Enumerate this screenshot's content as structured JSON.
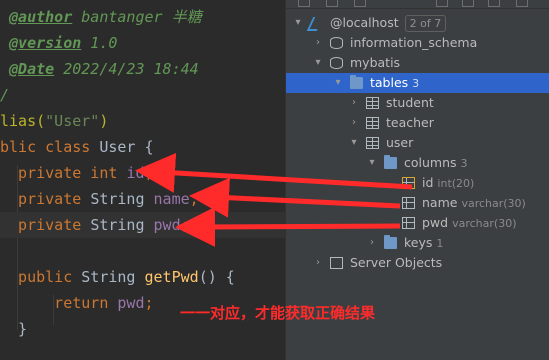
{
  "editor": {
    "lines": [
      {
        "segments": [
          {
            "t": " ",
            "c": "doc"
          },
          {
            "t": "@author",
            "c": "tag"
          },
          {
            "t": " bantanger 半糖",
            "c": "doc"
          }
        ]
      },
      {
        "segments": [
          {
            "t": " ",
            "c": "doc"
          },
          {
            "t": "@version",
            "c": "tag"
          },
          {
            "t": " 1.0",
            "c": "doc"
          }
        ]
      },
      {
        "segments": [
          {
            "t": " ",
            "c": "doc"
          },
          {
            "t": "@Date",
            "c": "tag"
          },
          {
            "t": " 2022/4/23 18:44",
            "c": "doc"
          }
        ]
      },
      {
        "segments": [
          {
            "t": "/",
            "c": "doc"
          }
        ]
      },
      {
        "segments": [
          {
            "t": "lias(",
            "c": "ann"
          },
          {
            "t": "\"User\"",
            "c": "str"
          },
          {
            "t": ")",
            "c": "ann"
          }
        ]
      },
      {
        "segments": [
          {
            "t": "blic class ",
            "c": "kw"
          },
          {
            "t": "User {",
            "c": ""
          }
        ]
      },
      {
        "segments": [
          {
            "t": "  private int ",
            "c": "kw"
          },
          {
            "t": "id",
            "c": "fld"
          },
          {
            "t": ";",
            "c": "kw"
          }
        ]
      },
      {
        "segments": [
          {
            "t": "  private ",
            "c": "kw"
          },
          {
            "t": "String ",
            "c": ""
          },
          {
            "t": "name",
            "c": "fld"
          },
          {
            "t": ";",
            "c": "kw"
          }
        ]
      },
      {
        "segments": [
          {
            "t": "  private ",
            "c": "kw"
          },
          {
            "t": "String ",
            "c": ""
          },
          {
            "t": "pwd",
            "c": "fld"
          },
          {
            "t": ";",
            "c": "kw"
          }
        ]
      },
      {
        "segments": [
          {
            "t": "",
            "c": ""
          }
        ]
      },
      {
        "segments": [
          {
            "t": "  public ",
            "c": "kw"
          },
          {
            "t": "String ",
            "c": ""
          },
          {
            "t": "getPwd",
            "c": "mth"
          },
          {
            "t": "() {",
            "c": ""
          }
        ]
      },
      {
        "segments": [
          {
            "t": "      return ",
            "c": "kw"
          },
          {
            "t": "pwd",
            "c": "fld"
          },
          {
            "t": ";",
            "c": "kw"
          }
        ]
      },
      {
        "segments": [
          {
            "t": "  }",
            "c": ""
          }
        ]
      }
    ]
  },
  "db_tree": {
    "items": [
      {
        "label": "@localhost",
        "badge": "2 of 7",
        "icon": "server-icon",
        "arrow": "▾"
      },
      {
        "label": "information_schema",
        "icon": "database-icon",
        "arrow": "›"
      },
      {
        "label": "mybatis",
        "icon": "database-icon",
        "arrow": "▾"
      },
      {
        "label": "tables",
        "count": "3",
        "icon": "folder-icon",
        "arrow": "▾",
        "selected": true
      },
      {
        "label": "student",
        "icon": "table-icon",
        "arrow": "›"
      },
      {
        "label": "teacher",
        "icon": "table-icon",
        "arrow": "›"
      },
      {
        "label": "user",
        "icon": "table-icon",
        "arrow": "▾"
      },
      {
        "label": "columns",
        "count": "3",
        "icon": "folder-icon",
        "arrow": "▾"
      },
      {
        "label": "id",
        "type": "int(20)",
        "icon": "primary-key-column-icon",
        "arrow": ""
      },
      {
        "label": "name",
        "type": "varchar(30)",
        "icon": "column-icon",
        "arrow": ""
      },
      {
        "label": "pwd",
        "type": "varchar(30)",
        "icon": "column-icon",
        "arrow": ""
      },
      {
        "label": "keys",
        "count": "1",
        "icon": "folder-icon",
        "arrow": "›"
      },
      {
        "label": "Server Objects",
        "icon": "server-objects-icon",
        "arrow": "›"
      }
    ]
  },
  "annotation": {
    "text": "一一对应，才能获取正确结果",
    "color": "#ff2b2b"
  },
  "colors": {
    "selected_row": "#2f65ca",
    "panel_bg": "#3c3f41",
    "editor_bg": "#2b2b2b"
  }
}
